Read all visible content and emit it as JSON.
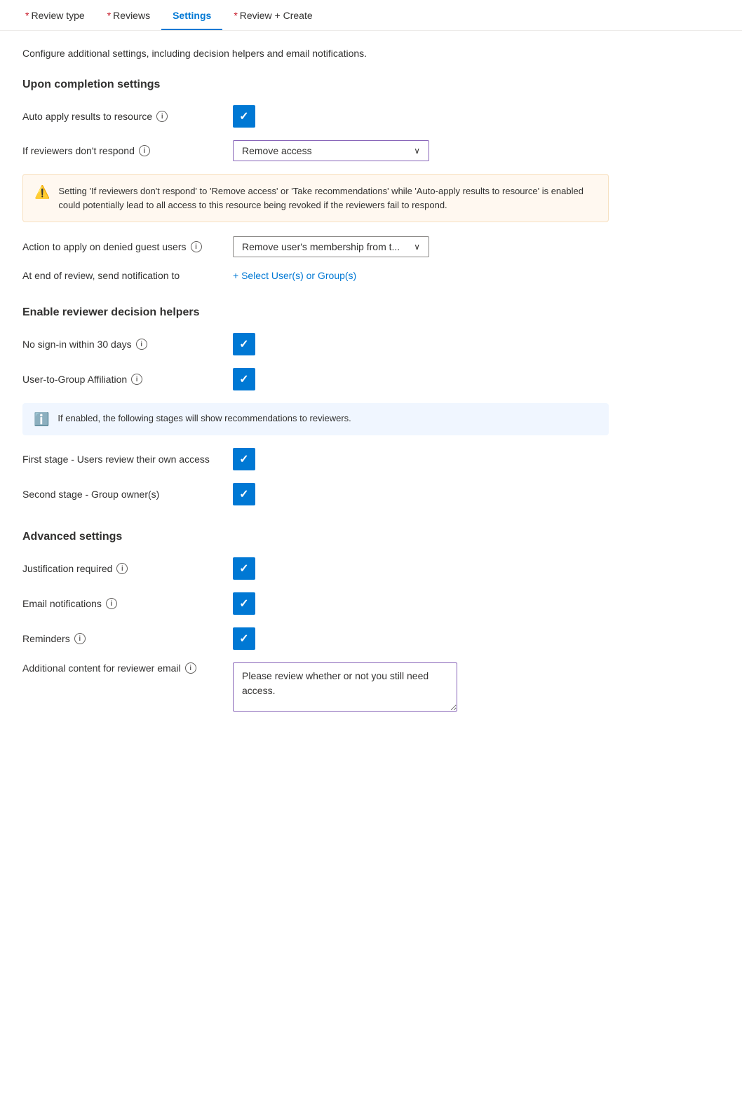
{
  "tabs": [
    {
      "id": "review-type",
      "label": "Review type",
      "required": true,
      "active": false
    },
    {
      "id": "reviews",
      "label": "Reviews",
      "required": true,
      "active": false
    },
    {
      "id": "settings",
      "label": "Settings",
      "required": false,
      "active": true
    },
    {
      "id": "review-create",
      "label": "Review + Create",
      "required": true,
      "active": false
    }
  ],
  "subtitle": "Configure additional settings, including decision helpers and email notifications.",
  "sections": {
    "upon_completion": {
      "title": "Upon completion settings",
      "auto_apply_label": "Auto apply results to resource",
      "auto_apply_checked": true,
      "if_reviewers_label": "If reviewers don't respond",
      "if_reviewers_value": "Remove access",
      "warning_text": "Setting 'If reviewers don't respond' to 'Remove access' or 'Take recommendations' while 'Auto-apply results to resource' is enabled could potentially lead to all access to this resource being revoked if the reviewers fail to respond.",
      "action_denied_label": "Action to apply on denied guest users",
      "action_denied_value": "Remove user's membership from t...",
      "notification_label": "At end of review, send notification to",
      "notification_link": "+ Select User(s) or Group(s)"
    },
    "decision_helpers": {
      "title": "Enable reviewer decision helpers",
      "no_signin_label": "No sign-in within 30 days",
      "no_signin_checked": true,
      "user_group_label": "User-to-Group Affiliation",
      "user_group_checked": true,
      "info_text": "If enabled, the following stages will show recommendations to reviewers.",
      "first_stage_label": "First stage - Users review their own access",
      "first_stage_checked": true,
      "second_stage_label": "Second stage - Group owner(s)",
      "second_stage_checked": true
    },
    "advanced": {
      "title": "Advanced settings",
      "justification_label": "Justification required",
      "justification_checked": true,
      "email_label": "Email notifications",
      "email_checked": true,
      "reminders_label": "Reminders",
      "reminders_checked": true,
      "additional_content_label": "Additional content for reviewer email",
      "additional_content_value": "Please review whether or not you still need access."
    }
  },
  "icons": {
    "info": "i",
    "warning": "⚠",
    "info_circle": "ℹ",
    "check": "✓",
    "chevron_down": "∨"
  }
}
